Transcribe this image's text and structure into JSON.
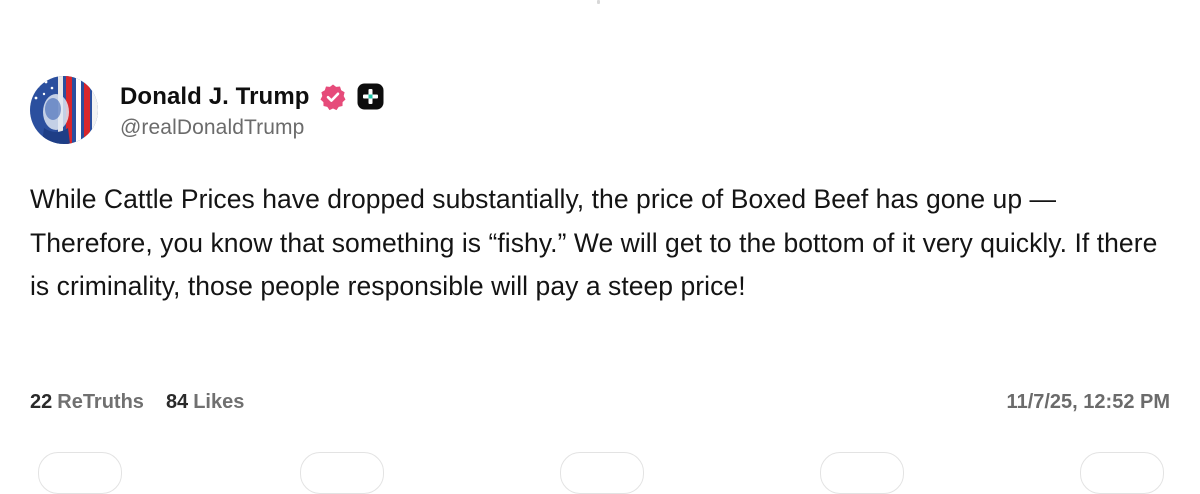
{
  "author": {
    "display_name": "Donald J. Trump",
    "handle": "@realDonaldTrump",
    "verified_icon": "verified-badge-icon",
    "membership_icon": "truth-plus-icon",
    "accent_color": "#e64b7a"
  },
  "post": {
    "text": "While Cattle Prices have dropped substantially, the price of Boxed Beef has gone up — Therefore, you know that something is “fishy.” We will get to the bottom of it very quickly. If there is criminality, those people responsible will pay a steep price!"
  },
  "stats": {
    "retruths_count": "22",
    "retruths_label": "ReTruths",
    "likes_count": "84",
    "likes_label": "Likes",
    "timestamp": "11/7/25, 12:52 PM"
  }
}
